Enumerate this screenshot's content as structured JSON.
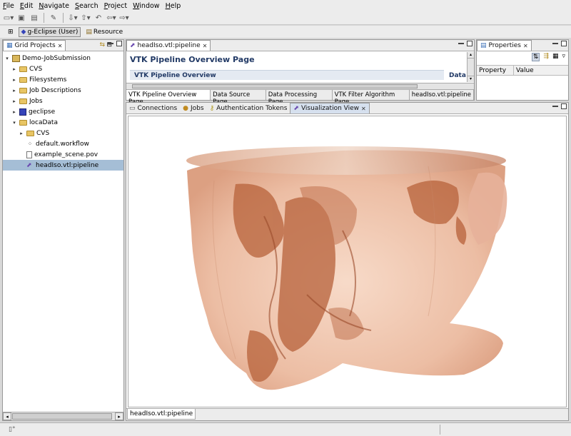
{
  "menu": [
    "File",
    "Edit",
    "Navigate",
    "Search",
    "Project",
    "Window",
    "Help"
  ],
  "perspectives": {
    "active": "g-Eclipse (User)",
    "other": "Resource"
  },
  "grid_projects": {
    "title": "Grid Projects",
    "tree": [
      {
        "label": "Demo-JobSubmission",
        "icon": "project-icon",
        "indent": 0,
        "twisty": "▾"
      },
      {
        "label": "CVS",
        "icon": "folder-icon",
        "indent": 1,
        "twisty": "▸"
      },
      {
        "label": "Filesystems",
        "icon": "folder-icon",
        "indent": 1,
        "twisty": "▸"
      },
      {
        "label": "Job Descriptions",
        "icon": "folder-icon",
        "indent": 1,
        "twisty": "▸"
      },
      {
        "label": "Jobs",
        "icon": "folder-icon",
        "indent": 1,
        "twisty": "▸"
      },
      {
        "label": "geclipse",
        "icon": "geclipse-icon",
        "indent": 1,
        "twisty": "▸"
      },
      {
        "label": "locaData",
        "icon": "folder-icon",
        "indent": 1,
        "twisty": "▾"
      },
      {
        "label": "CVS",
        "icon": "folder-icon",
        "indent": 2,
        "twisty": "▸"
      },
      {
        "label": "default.workflow",
        "icon": "workflow-icon",
        "indent": 2,
        "twisty": ""
      },
      {
        "label": "example_scene.pov",
        "icon": "file-icon",
        "indent": 2,
        "twisty": ""
      },
      {
        "label": "headIso.vtl:pipeline",
        "icon": "pipeline-icon",
        "indent": 2,
        "twisty": "",
        "selected": true
      }
    ]
  },
  "editor": {
    "tab": "headIso.vtl:pipeline",
    "page_title": "VTK Pipeline Overview Page",
    "section_title": "VTK Pipeline Overview",
    "side_label": "Data",
    "pages": [
      "VTK Pipeline Overview Page",
      "Data Source Page",
      "Data Processing Page",
      "VTK Filter Algorithm Page",
      "headIso.vtl:pipeline"
    ]
  },
  "properties": {
    "title": "Properties",
    "col_property": "Property",
    "col_value": "Value"
  },
  "bottom_tabs": [
    {
      "label": "Connections",
      "icon": "connections-icon"
    },
    {
      "label": "Jobs",
      "icon": "jobs-icon"
    },
    {
      "label": "Authentication Tokens",
      "icon": "key-icon"
    },
    {
      "label": "Visualization View",
      "icon": "visualization-icon",
      "selected": true
    }
  ],
  "viz_footer_tab": "headIso.vtl:pipeline",
  "colors": {
    "selection": "#a5bed6",
    "render_bg": "#ffffff",
    "iso_surface": "#c8704a"
  }
}
